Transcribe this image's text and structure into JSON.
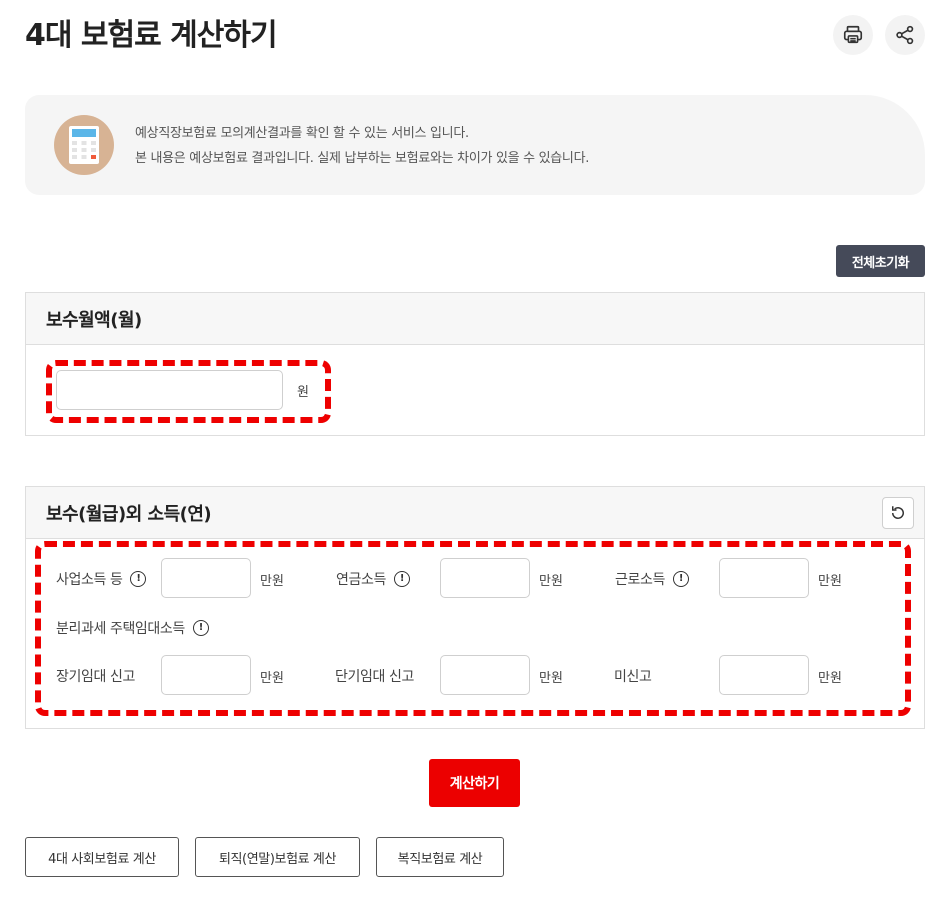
{
  "page": {
    "title": "4대 보험료 계산하기"
  },
  "toolbar": {
    "print_icon": "print-icon",
    "share_icon": "share-icon"
  },
  "info": {
    "icon": "calculator-icon",
    "line1": "예상직장보험료 모의계산결과를 확인 할 수 있는 서비스 입니다.",
    "line2": "본 내용은 예상보험료 결과입니다. 실제 납부하는 보험료와는 차이가 있을 수 있습니다."
  },
  "actions": {
    "reset_all_label": "전체초기화"
  },
  "salary_panel": {
    "title": "보수월액(월)",
    "input_value": "",
    "unit": "원"
  },
  "other_income_panel": {
    "title": "보수(월급)외 소득(연)",
    "refresh_icon": "refresh-icon",
    "fields": [
      {
        "label": "사업소득 등",
        "help": "!",
        "value": "",
        "unit": "만원"
      },
      {
        "label": "연금소득",
        "help": "!",
        "value": "",
        "unit": "만원"
      },
      {
        "label": "근로소득",
        "help": "!",
        "value": "",
        "unit": "만원"
      }
    ],
    "rental_label": "분리과세 주택임대소득",
    "rental_help": "!",
    "rental_fields": [
      {
        "label": "장기임대 신고",
        "value": "",
        "unit": "만원"
      },
      {
        "label": "단기임대 신고",
        "value": "",
        "unit": "만원"
      },
      {
        "label": "미신고",
        "value": "",
        "unit": "만원"
      }
    ]
  },
  "calculate_label": "계산하기",
  "links": [
    {
      "label": "4대 사회보험료 계산"
    },
    {
      "label": "퇴직(연말)보험료 계산"
    },
    {
      "label": "복직보험료 계산"
    }
  ],
  "colors": {
    "accent_red": "#ec0000",
    "dark_button": "#454a59",
    "dash_red": "#ee0000"
  }
}
